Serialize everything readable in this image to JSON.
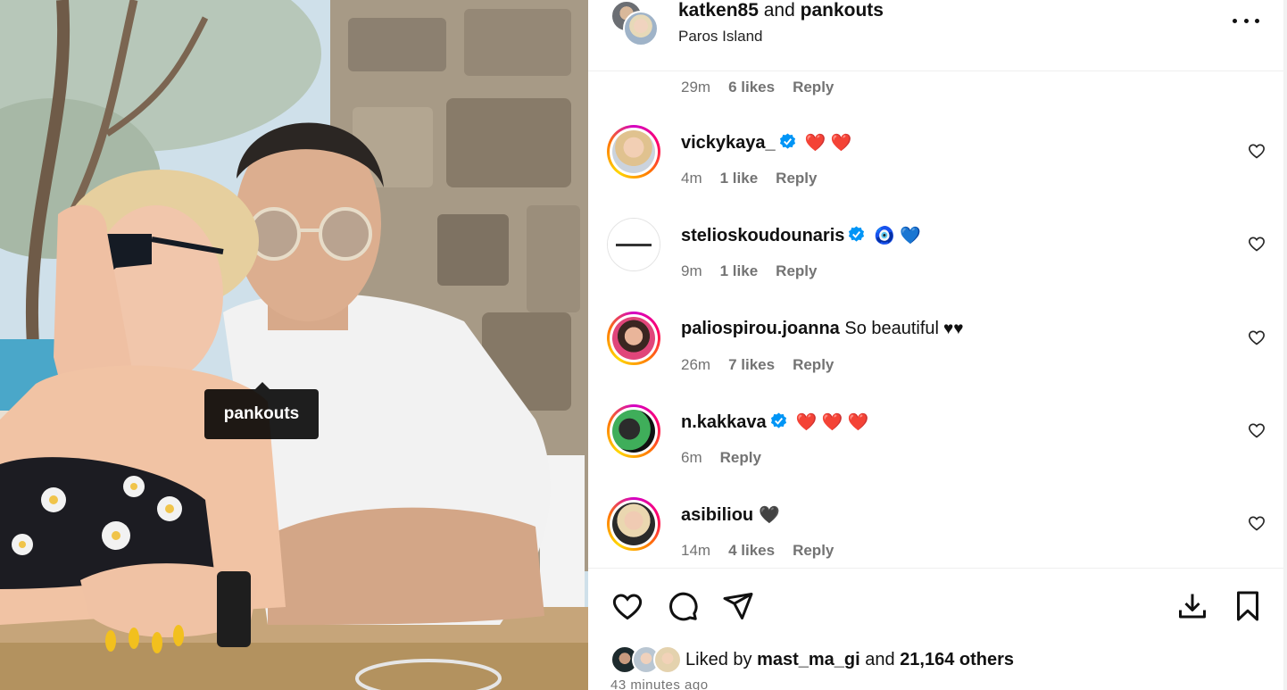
{
  "post": {
    "author_1": "katken85",
    "joiner": "and",
    "author_2": "pankouts",
    "location": "Paros Island",
    "more_icon": "more-horizontal-icon"
  },
  "photo": {
    "tag_label": "pankouts"
  },
  "previous_comment_meta": {
    "time": "29m",
    "likes": "6 likes",
    "reply": "Reply"
  },
  "comments": [
    {
      "username": "vickykaya_",
      "verified": true,
      "text": "",
      "emoji": "❤️ ❤️",
      "time": "4m",
      "likes": "1 like",
      "reply": "Reply",
      "ring": true
    },
    {
      "username": "stelioskoudounaris",
      "verified": true,
      "text": "",
      "emoji": "🧿 💙",
      "time": "9m",
      "likes": "1 like",
      "reply": "Reply",
      "ring": false
    },
    {
      "username": "paliospirou.joanna",
      "verified": false,
      "text": "So beautiful",
      "emoji": "♥♥",
      "time": "26m",
      "likes": "7 likes",
      "reply": "Reply",
      "ring": true
    },
    {
      "username": "n.kakkava",
      "verified": true,
      "text": "",
      "emoji": "❤️ ❤️ ❤️",
      "time": "6m",
      "likes": "",
      "reply": "Reply",
      "ring": true
    },
    {
      "username": "asibiliou",
      "verified": false,
      "text": "",
      "emoji": "🖤",
      "time": "14m",
      "likes": "4 likes",
      "reply": "Reply",
      "ring": true
    }
  ],
  "actions": {
    "like_icon": "heart-outline-icon",
    "comment_icon": "comment-bubble-icon",
    "share_icon": "paper-plane-icon",
    "download_icon": "download-icon",
    "save_icon": "bookmark-icon"
  },
  "likes_summary": {
    "prefix": "Liked by",
    "user": "mast_ma_gi",
    "middle": "and",
    "others": "21,164 others"
  },
  "time_ago": "43 minutes ago",
  "colors": {
    "verified_blue": "#0095f6",
    "meta_gray": "#737373",
    "heart_red": "#e0245e"
  }
}
